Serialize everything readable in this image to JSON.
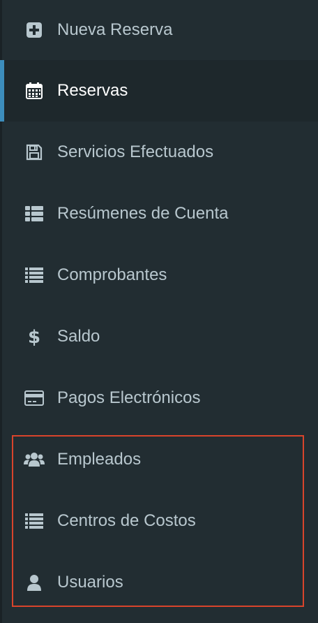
{
  "colors": {
    "background": "#222d32",
    "active_background": "#1e282c",
    "active_accent": "#3c8dbc",
    "text": "#b8c7ce",
    "active_text": "#ffffff",
    "highlight_border": "#d9442b"
  },
  "menu": {
    "items": [
      {
        "label": "Nueva Reserva",
        "icon": "plus-square-icon",
        "active": false
      },
      {
        "label": "Reservas",
        "icon": "calendar-icon",
        "active": true
      },
      {
        "label": "Servicios Efectuados",
        "icon": "save-icon",
        "active": false
      },
      {
        "label": "Resúmenes de Cuenta",
        "icon": "list-alt-icon",
        "active": false
      },
      {
        "label": "Comprobantes",
        "icon": "list-icon",
        "active": false
      },
      {
        "label": "Saldo",
        "icon": "dollar-icon",
        "active": false
      },
      {
        "label": "Pagos Electrónicos",
        "icon": "credit-card-icon",
        "active": false
      },
      {
        "label": "Empleados",
        "icon": "users-icon",
        "active": false
      },
      {
        "label": "Centros de Costos",
        "icon": "list-icon",
        "active": false
      },
      {
        "label": "Usuarios",
        "icon": "user-icon",
        "active": false
      }
    ]
  }
}
